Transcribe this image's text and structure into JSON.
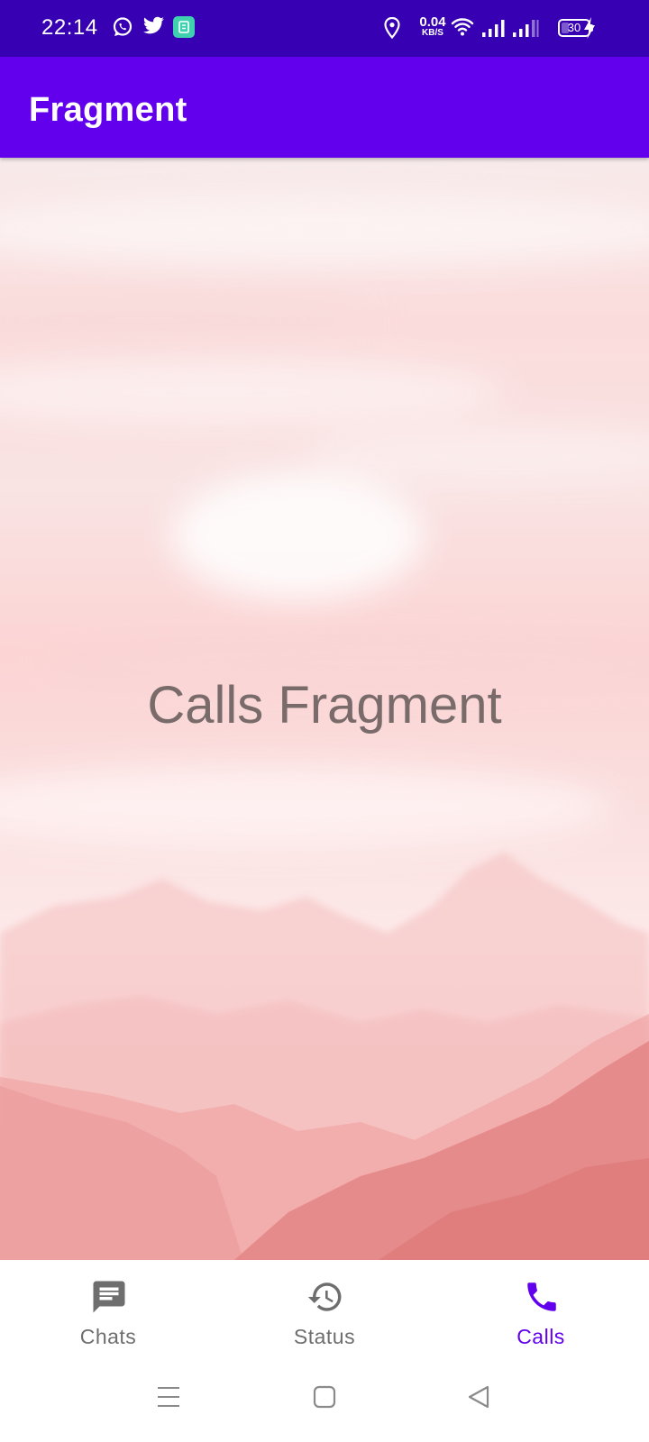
{
  "status_bar": {
    "time": "22:14",
    "notification_icons": [
      "whatsapp-icon",
      "twitter-icon",
      "app-notification-icon"
    ],
    "net_speed_value": "0.04",
    "net_speed_unit": "KB/S",
    "battery_level": "30",
    "battery_fraction": 0.3,
    "charging": true,
    "background_color": "#3700b3"
  },
  "app_bar": {
    "title": "Fragment",
    "background_color": "#6200ee"
  },
  "content": {
    "text": "Calls Fragment"
  },
  "bottom_nav": {
    "active_color": "#6200ee",
    "inactive_color": "#6e6e6e",
    "items": [
      {
        "label": "Chats",
        "icon": "chat-icon",
        "active": false
      },
      {
        "label": "Status",
        "icon": "history-icon",
        "active": false
      },
      {
        "label": "Calls",
        "icon": "phone-icon",
        "active": true
      }
    ]
  },
  "system_nav": {
    "buttons": [
      "menu-icon",
      "home-icon",
      "back-icon"
    ]
  }
}
